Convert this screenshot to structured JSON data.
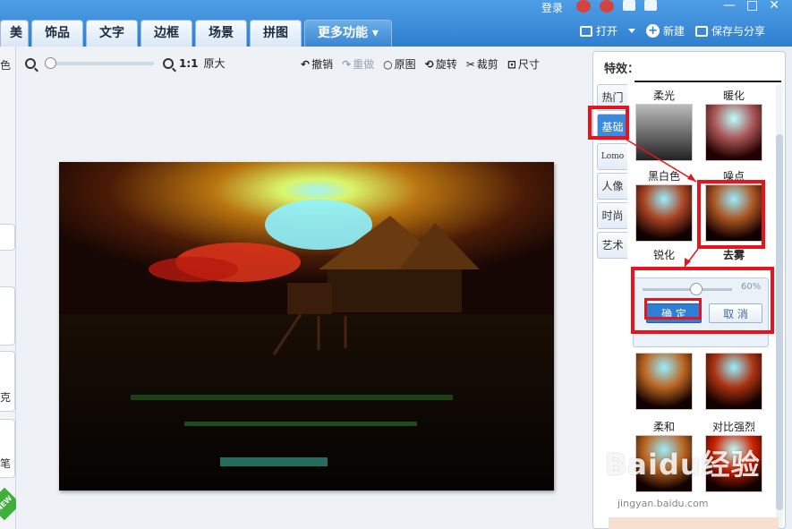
{
  "topbar": {
    "login": "登录",
    "tabs": [
      "美容",
      "饰品",
      "文字",
      "边框",
      "场景",
      "拼图",
      "更多功能"
    ],
    "open": "打开",
    "new": "新建",
    "save_share": "保存与分享",
    "window": {
      "min": "—",
      "max": "□",
      "close": "✕"
    }
  },
  "leftstrip": {
    "labels": [
      "色",
      "克",
      "笔"
    ],
    "badge": "NEW"
  },
  "toolbar": {
    "ratio": "1:1",
    "original_size": "原大",
    "zoom_level": 0.0,
    "actions": [
      {
        "icon": "undo-icon",
        "label": "撤销",
        "enabled": true
      },
      {
        "icon": "redo-icon",
        "label": "重做",
        "enabled": false
      },
      {
        "icon": "original-icon",
        "label": "原图",
        "enabled": true
      },
      {
        "icon": "rotate-icon",
        "label": "旋转",
        "enabled": true
      },
      {
        "icon": "crop-icon",
        "label": "裁剪",
        "enabled": true
      },
      {
        "icon": "resize-icon",
        "label": "尺寸",
        "enabled": true
      }
    ]
  },
  "panel": {
    "title": "特效：",
    "side_tabs": [
      "热门",
      "基础",
      "Lomo",
      "人像",
      "时尚",
      "艺术"
    ],
    "active_tab": "基础",
    "effects": [
      "柔光",
      "暖化",
      "黑白色",
      "噪点",
      "锐化",
      "去雾",
      "柔和",
      "对比强烈"
    ],
    "adjust": {
      "percent_label": "60%",
      "value": 0.6,
      "ok": "确 定",
      "cancel": "取 消"
    }
  },
  "watermark": {
    "brand": "Baidu经验",
    "sub": "jingyan.baidu.com"
  },
  "colors": {
    "accent": "#2f7fcf",
    "highlight": "#e6141d"
  }
}
